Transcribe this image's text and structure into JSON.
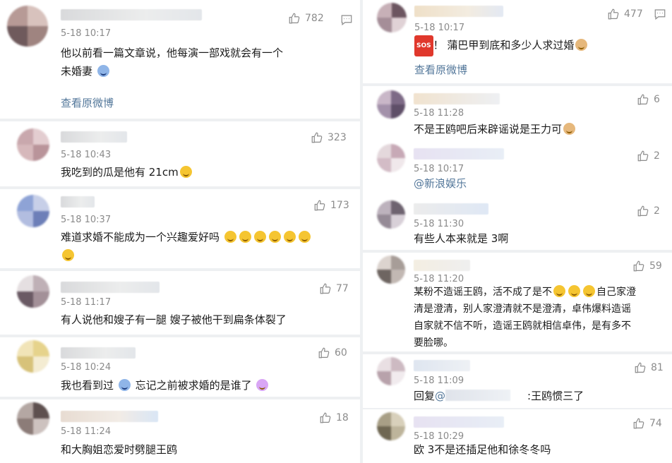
{
  "left_comments": [
    {
      "time": "5-18 10:17",
      "likes": "782",
      "text": "他以前看一篇文章说，他每演一部戏就会有一个",
      "text2": "未婚妻",
      "link": "查看原微博"
    },
    {
      "time": "5-18 10:43",
      "likes": "323",
      "text": "我吃到的瓜是他有 21cm"
    },
    {
      "time": "5-18 10:37",
      "likes": "173",
      "text": "难道求婚不能成为一个兴趣爱好吗"
    },
    {
      "time": "5-18 11:17",
      "likes": "77",
      "text": "有人说他和嫂子有一腿 嫂子被他干到扁条体裂了"
    },
    {
      "time": "5-18 10:24",
      "likes": "60",
      "text_a": "我也看到过",
      "text_b": "忘记之前被求婚的是谁了"
    },
    {
      "time": "5-18 11:24",
      "likes": "18",
      "text": "和大胸姐恋爱时劈腿王鸥"
    }
  ],
  "right_comments": [
    {
      "time": "5-18 10:17",
      "likes": "477",
      "text": "！ 蒲巴甲到底和多少人求过婚",
      "link": "查看原微博",
      "badge": "SOS"
    },
    {
      "time": "5-18 11:28",
      "likes": "6",
      "text": "不是王鸥吧后来辟谣说是王力可"
    },
    {
      "time": "5-18 10:17",
      "likes": "2",
      "text": "@新浪娱乐"
    },
    {
      "time": "5-18 11:30",
      "likes": "2",
      "text": "有些人本来就是 3啊"
    },
    {
      "time": "5-18 11:20",
      "likes": "59",
      "line1a": "某粉不造谣王鸥，活不成了是不",
      "line1b": "自己家澄",
      "line2": "清是澄清，别人家澄清就不是澄清，卓伟爆料造谣",
      "line3": "自家就不信不听，造谣王鸥就相信卓伟，是有多不",
      "line4": "要脸哪。"
    },
    {
      "time": "5-18 11:09",
      "likes": "81",
      "reply_prefix": "回复",
      "reply_at": "@",
      "reply_tail": ":王鸥惯三了"
    },
    {
      "time": "5-18 10:29",
      "likes": "74",
      "text": "欧 3不是还插足他和徐冬冬吗"
    }
  ],
  "icons": {
    "like": "thumbs-up-icon",
    "comment": "comment-icon"
  },
  "colors": {
    "link": "#53779a",
    "meta": "#8a8a8a",
    "background": "#eef0f2"
  }
}
